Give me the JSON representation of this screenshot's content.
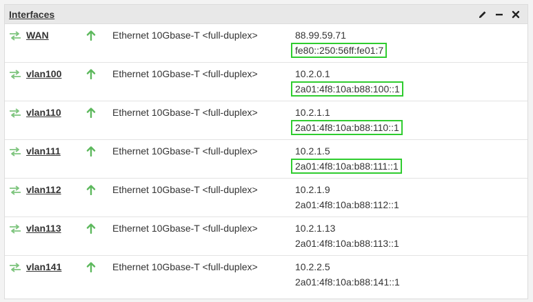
{
  "panel": {
    "title": "Interfaces",
    "tools": [
      "pencil-icon",
      "minimize-icon",
      "close-icon"
    ]
  },
  "colors": {
    "status_icon": "#7dc47d",
    "up_arrow": "#5cb85c",
    "highlight_border": "#2ecc2e"
  },
  "interfaces": [
    {
      "name": "WAN",
      "media": "Ethernet 10Gbase-T <full-duplex>",
      "ipv4": "88.99.59.71",
      "ipv6": "fe80::250:56ff:fe01:7",
      "ipv6_highlighted": true
    },
    {
      "name": "vlan100",
      "media": "Ethernet 10Gbase-T <full-duplex>",
      "ipv4": "10.2.0.1",
      "ipv6": "2a01:4f8:10a:b88:100::1",
      "ipv6_highlighted": true
    },
    {
      "name": "vlan110",
      "media": "Ethernet 10Gbase-T <full-duplex>",
      "ipv4": "10.2.1.1",
      "ipv6": "2a01:4f8:10a:b88:110::1",
      "ipv6_highlighted": true
    },
    {
      "name": "vlan111",
      "media": "Ethernet 10Gbase-T <full-duplex>",
      "ipv4": "10.2.1.5",
      "ipv6": "2a01:4f8:10a:b88:111::1",
      "ipv6_highlighted": true
    },
    {
      "name": "vlan112",
      "media": "Ethernet 10Gbase-T <full-duplex>",
      "ipv4": "10.2.1.9",
      "ipv6": "2a01:4f8:10a:b88:112::1",
      "ipv6_highlighted": false
    },
    {
      "name": "vlan113",
      "media": "Ethernet 10Gbase-T <full-duplex>",
      "ipv4": "10.2.1.13",
      "ipv6": "2a01:4f8:10a:b88:113::1",
      "ipv6_highlighted": false
    },
    {
      "name": "vlan141",
      "media": "Ethernet 10Gbase-T <full-duplex>",
      "ipv4": "10.2.2.5",
      "ipv6": "2a01:4f8:10a:b88:141::1",
      "ipv6_highlighted": false
    }
  ]
}
